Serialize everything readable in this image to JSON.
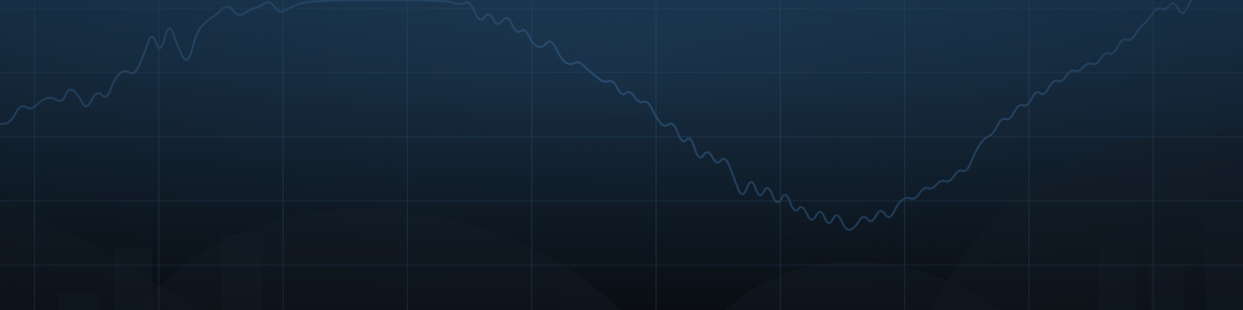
{
  "banner": {
    "description_visible_text": "",
    "colors": {
      "top": "#1c3a55",
      "bottom": "#0e141c",
      "grid": "#2c4a66",
      "line": "#2a4f72",
      "shape": "#1a2633"
    }
  }
}
